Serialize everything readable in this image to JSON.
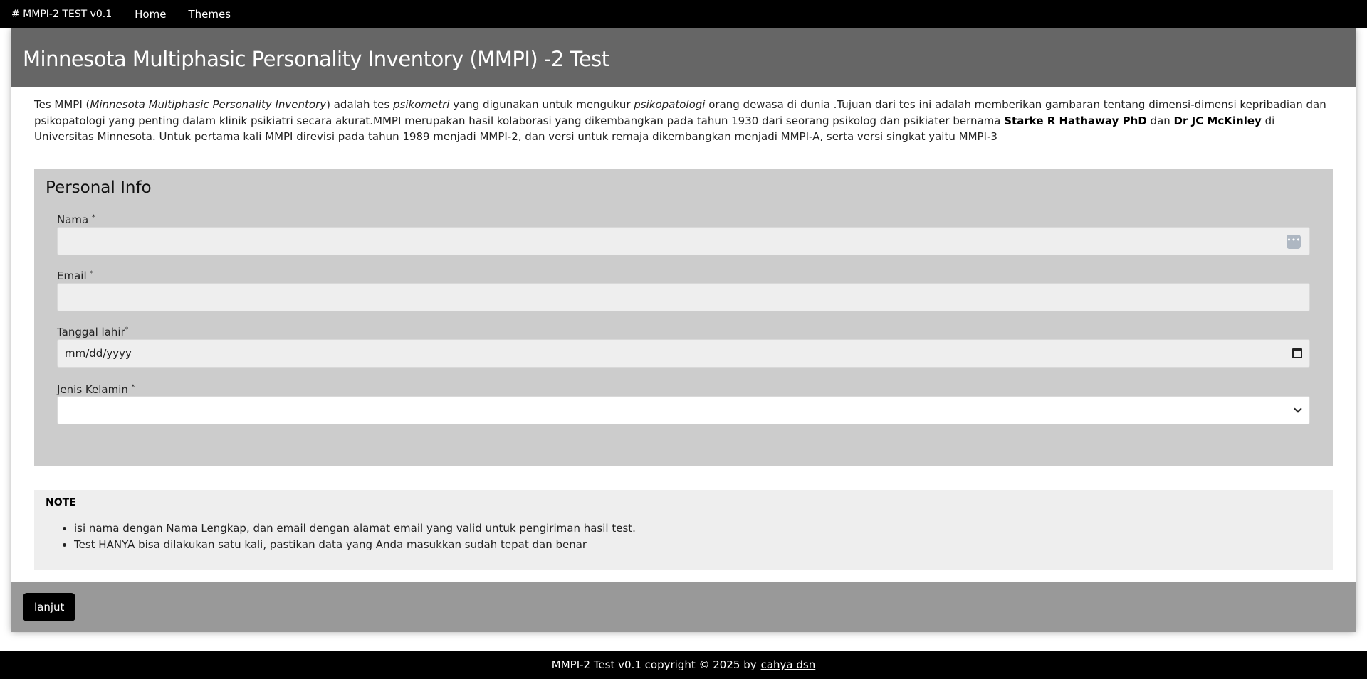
{
  "nav": {
    "brand": "# MMPI-2 TEST v0.1",
    "links": [
      "Home",
      "Themes"
    ]
  },
  "header": {
    "title": "Minnesota Multiphasic Personality Inventory (MMPI) -2 Test"
  },
  "intro": {
    "p1": "Tes MMPI (",
    "p2": "Minnesota Multiphasic Personality Inventory",
    "p3": ") adalah tes ",
    "p4": "psikometri",
    "p5": " yang digunakan untuk mengukur ",
    "p6": "psikopatologi",
    "p7": " orang dewasa di dunia .Tujuan dari tes ini adalah memberikan gambaran tentang dimensi-dimensi kepribadian dan psikopatologi yang penting dalam klinik psikiatri secara akurat.MMPI merupakan hasil kolaborasi yang dikembangkan pada tahun 1930 dari seorang psikolog dan psikiater bernama ",
    "p8": "Starke R Hathaway PhD",
    "p9": " dan ",
    "p10": "Dr JC McKinley",
    "p11": " di Universitas Minnesota. Untuk pertama kali MMPI direvisi pada tahun 1989 menjadi MMPI-2, dan versi untuk remaja dikembangkan menjadi MMPI-A, serta versi singkat yaitu MMPI-3"
  },
  "form": {
    "section_title": "Personal Info",
    "required_mark": "*",
    "nama_label": "Nama",
    "email_label": "Email",
    "dob_label": "Tanggal lahir",
    "dob_placeholder": "mm/dd/yyyy",
    "gender_label": "Jenis Kelamin",
    "nama_value": "",
    "email_value": "",
    "gender_value": ""
  },
  "note": {
    "title": "NOTE",
    "items": [
      "isi nama dengan Nama Lengkap, dan email dengan alamat email yang valid untuk pengiriman hasil test.",
      "Test HANYA bisa dilakukan satu kali, pastikan data yang Anda masukkan sudah tepat dan benar"
    ]
  },
  "actions": {
    "next_label": "lanjut"
  },
  "footer": {
    "text": "MMPI-2 Test v0.1 copyright © 2025 by",
    "link": "cahya dsn"
  }
}
